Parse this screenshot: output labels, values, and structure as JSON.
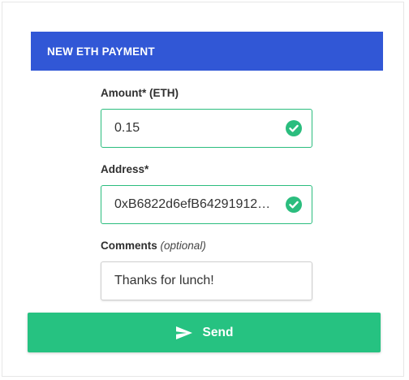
{
  "header": {
    "title": "NEW ETH PAYMENT"
  },
  "fields": {
    "amount": {
      "label": "Amount* (ETH)",
      "value": "0.15",
      "valid": true
    },
    "address": {
      "label": "Address*",
      "value": "0xB6822d6efB64291912…",
      "valid": true
    },
    "comments": {
      "label": "Comments",
      "label_note": "(optional)",
      "value": "Thanks for lunch!"
    }
  },
  "send_button": {
    "label": "Send",
    "icon": "send-icon"
  },
  "colors": {
    "header_bg": "#3157d6",
    "valid_border": "#2bbd7e",
    "check_green": "#2bbd7e",
    "button_bg": "#26c281"
  }
}
